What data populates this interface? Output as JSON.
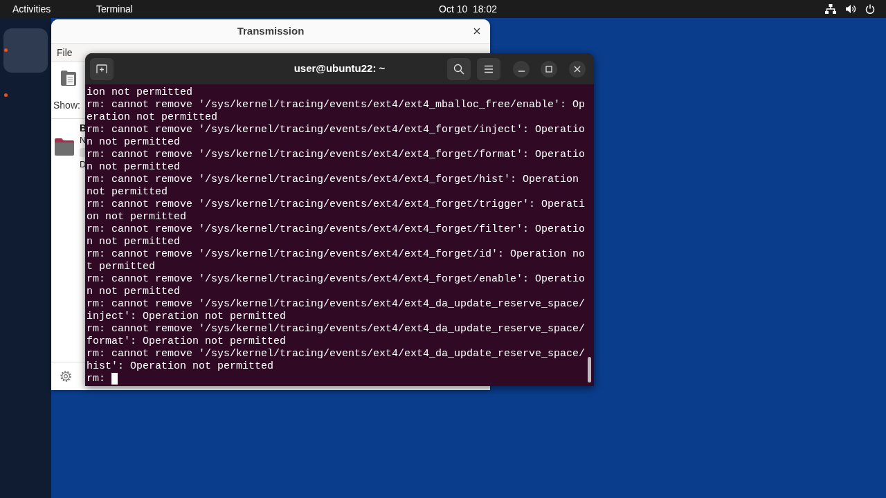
{
  "top_bar": {
    "activities": "Activities",
    "app_menu": "Terminal",
    "clock": "Oct 10  18:02"
  },
  "dock": {
    "items": [
      {
        "selected": true,
        "running": true
      },
      {
        "selected": false,
        "running": true
      }
    ]
  },
  "transmission": {
    "title": "Transmission",
    "menu": [
      "File"
    ],
    "filter_label": "Show:",
    "torrent": {
      "name": "B",
      "line_2": "N",
      "line_3": "D"
    }
  },
  "terminal": {
    "title": "user@ubuntu22: ~",
    "lines": [
      "ion not permitted",
      "rm: cannot remove '/sys/kernel/tracing/events/ext4/ext4_mballoc_free/enable': Op",
      "eration not permitted",
      "rm: cannot remove '/sys/kernel/tracing/events/ext4/ext4_forget/inject': Operatio",
      "n not permitted",
      "rm: cannot remove '/sys/kernel/tracing/events/ext4/ext4_forget/format': Operatio",
      "n not permitted",
      "rm: cannot remove '/sys/kernel/tracing/events/ext4/ext4_forget/hist': Operation",
      "not permitted",
      "rm: cannot remove '/sys/kernel/tracing/events/ext4/ext4_forget/trigger': Operati",
      "on not permitted",
      "rm: cannot remove '/sys/kernel/tracing/events/ext4/ext4_forget/filter': Operatio",
      "n not permitted",
      "rm: cannot remove '/sys/kernel/tracing/events/ext4/ext4_forget/id': Operation no",
      "t permitted",
      "rm: cannot remove '/sys/kernel/tracing/events/ext4/ext4_forget/enable': Operatio",
      "n not permitted",
      "rm: cannot remove '/sys/kernel/tracing/events/ext4/ext4_da_update_reserve_space/",
      "inject': Operation not permitted",
      "rm: cannot remove '/sys/kernel/tracing/events/ext4/ext4_da_update_reserve_space/",
      "format': Operation not permitted",
      "rm: cannot remove '/sys/kernel/tracing/events/ext4/ext4_da_update_reserve_space/",
      "hist': Operation not permitted"
    ],
    "prompt": "rm:"
  }
}
